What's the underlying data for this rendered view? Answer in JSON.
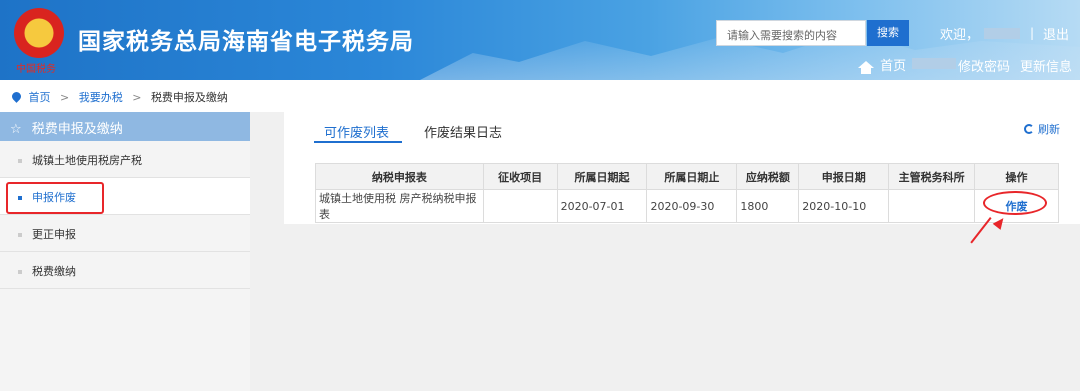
{
  "header": {
    "site_title": "国家税务总局海南省电子税务局",
    "emblem_text": "中国税务",
    "search_placeholder": "请输入需要搜索的内容",
    "search_button": "搜索",
    "welcome": "欢迎，",
    "separator": "|",
    "logout": "退出",
    "home": "首页",
    "change_password": "修改密码",
    "update_info": "更新信息"
  },
  "breadcrumb": {
    "home": "首页",
    "level1": "我要办税",
    "level2": "税费申报及缴纳",
    "arrow": ">"
  },
  "sidebar": {
    "title": "税费申报及缴纳",
    "items": [
      {
        "label": "城镇土地使用税房产税"
      },
      {
        "label": "申报作废"
      },
      {
        "label": "更正申报"
      },
      {
        "label": "税费缴纳"
      }
    ]
  },
  "main": {
    "tabs": [
      {
        "label": "可作废列表"
      },
      {
        "label": "作废结果日志"
      }
    ],
    "refresh": "刷新",
    "table": {
      "headers": [
        "纳税申报表",
        "征收项目",
        "所属日期起",
        "所属日期止",
        "应纳税额",
        "申报日期",
        "主管税务科所",
        "操作"
      ],
      "rows": [
        {
          "form": "城镇土地使用税 房产税纳税申报表",
          "item": "",
          "date_from": "2020-07-01",
          "date_to": "2020-09-30",
          "tax": "1800",
          "declare_date": "2020-10-10",
          "office": "",
          "action": "作废"
        }
      ]
    }
  },
  "colors": {
    "accent": "#1f6fcf",
    "highlight": "#e8262a",
    "sidebar_header": "#8fb8e2"
  }
}
